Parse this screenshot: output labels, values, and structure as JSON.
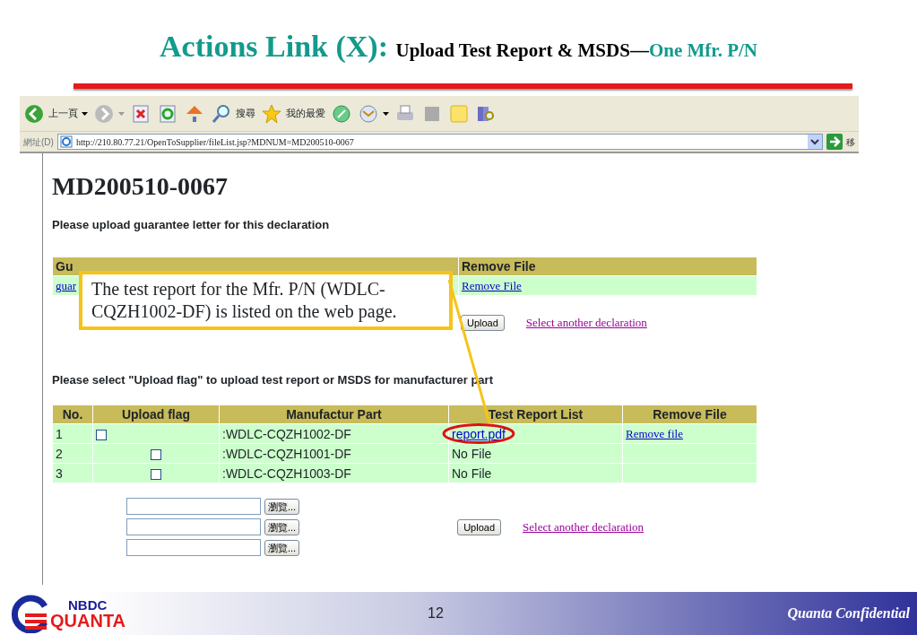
{
  "slide": {
    "title_parts": [
      "Actions Link (X): ",
      "Upload Test Report & MSDS—",
      "One Mfr. P/N"
    ]
  },
  "browser": {
    "toolbar": [
      {
        "kind": "back",
        "label": "上一頁"
      },
      {
        "kind": "forward"
      },
      {
        "kind": "stop"
      },
      {
        "kind": "refresh"
      },
      {
        "kind": "home"
      },
      {
        "kind": "search",
        "label": "搜尋"
      },
      {
        "kind": "favorites",
        "label": "我的最愛"
      },
      {
        "kind": "media"
      },
      {
        "kind": "mail"
      },
      {
        "kind": "print"
      },
      {
        "kind": "edit"
      },
      {
        "kind": "note"
      },
      {
        "kind": "research"
      }
    ],
    "address": {
      "label": "網址(D)",
      "url": "http://210.80.77.21/OpenToSupplier/fileList.jsp?MDNUM=MD200510-0067",
      "go_label": "移"
    }
  },
  "page": {
    "heading": "MD200510-0067",
    "guarantee": {
      "intro": "Please upload guarantee letter for this declaration",
      "columns": [
        "Gu",
        "Remove File"
      ],
      "row": [
        "guar",
        "Remove File"
      ],
      "upload_button": "Upload",
      "other_link": "Select another declaration"
    },
    "parts": {
      "intro": "Please select \"Upload flag\" to upload test report or MSDS for manufacturer part",
      "columns": [
        "No.",
        "Upload flag",
        "Manufactur Part",
        "Test Report List",
        "Remove File"
      ],
      "rows": [
        {
          "no": "1",
          "checked": false,
          "part": ":WDLC-CQZH1002-DF",
          "report": "report.pdf",
          "kind": "linked",
          "remove": "Remove file"
        },
        {
          "no": "2",
          "checked": false,
          "part": ":WDLC-CQZH1001-DF",
          "report": "No File",
          "kind": "empty"
        },
        {
          "no": "3",
          "checked": false,
          "part": ":WDLC-CQZH1003-DF",
          "report": "No File",
          "kind": "empty"
        }
      ],
      "browse_buttons": [
        "瀏覽...",
        "瀏覽...",
        "瀏覽..."
      ],
      "upload_button": "Upload",
      "other_link": "Select another declaration"
    }
  },
  "callout": {
    "text": "The test report for the Mfr. P/N (WDLC-CQZH1002-DF) is listed on the web page."
  },
  "footer": {
    "logo_top": "NBDC",
    "logo_bottom": "QUANTA",
    "page_number": "12",
    "confidential": "Quanta Confidential"
  }
}
